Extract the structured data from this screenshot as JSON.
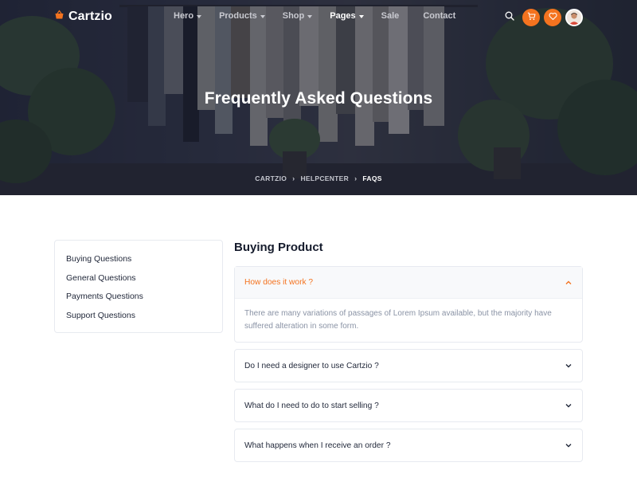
{
  "brand": {
    "name": "Cartzio",
    "accent": "#f4731f"
  },
  "nav": {
    "items": [
      {
        "label": "Hero",
        "dropdown": true,
        "active": false
      },
      {
        "label": "Products",
        "dropdown": true,
        "active": false
      },
      {
        "label": "Shop",
        "dropdown": true,
        "active": false
      },
      {
        "label": "Pages",
        "dropdown": true,
        "active": true
      },
      {
        "label": "Sale",
        "dropdown": false,
        "active": false
      },
      {
        "label": "Contact",
        "dropdown": false,
        "active": false
      }
    ],
    "icons": [
      "search-icon",
      "cart-icon",
      "heart-icon",
      "avatar"
    ]
  },
  "hero": {
    "title": "Frequently Asked Questions",
    "breadcrumb": [
      "CARTZIO",
      "HELPCENTER",
      "FAQS"
    ]
  },
  "sidebar": {
    "items": [
      "Buying Questions",
      "General Questions",
      "Payments Questions",
      "Support Questions"
    ]
  },
  "main": {
    "title": "Buying Product",
    "faqs": [
      {
        "question": "How does it work ?",
        "answer": "There are many variations of passages of Lorem Ipsum available, but the majority have suffered alteration in some form.",
        "expanded": true
      },
      {
        "question": "Do I need a designer to use Cartzio ?",
        "expanded": false
      },
      {
        "question": "What do I need to do to start selling ?",
        "expanded": false
      },
      {
        "question": "What happens when I receive an order ?",
        "expanded": false
      }
    ]
  }
}
